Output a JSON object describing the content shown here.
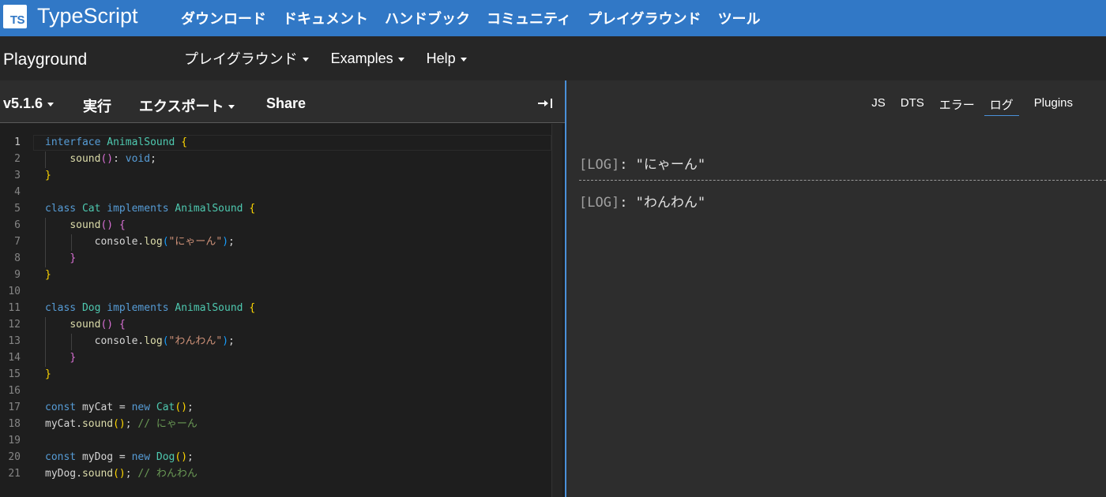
{
  "brand": {
    "logo_text": "TS",
    "name": "TypeScript"
  },
  "topnav": [
    {
      "label": "ダウンロード"
    },
    {
      "label": "ドキュメント"
    },
    {
      "label": "ハンドブック"
    },
    {
      "label": "コミュニティ"
    },
    {
      "label": "プレイグラウンド"
    },
    {
      "label": "ツール"
    }
  ],
  "subbar": {
    "title": "Playground",
    "menus": [
      {
        "label": "プレイグラウンド"
      },
      {
        "label": "Examples"
      },
      {
        "label": "Help"
      }
    ]
  },
  "toolbar": {
    "version": "v5.1.6",
    "run": "実行",
    "export": "エクスポート",
    "share": "Share"
  },
  "editor": {
    "active_line": 1,
    "line_numbers": [
      "1",
      "2",
      "3",
      "4",
      "5",
      "6",
      "7",
      "8",
      "9",
      "10",
      "11",
      "12",
      "13",
      "14",
      "15",
      "16",
      "17",
      "18",
      "19",
      "20",
      "21"
    ]
  },
  "output": {
    "tabs": [
      {
        "label": "JS",
        "active": false
      },
      {
        "label": "DTS",
        "active": false
      },
      {
        "label": "エラー",
        "active": false
      },
      {
        "label": "ログ",
        "active": true
      },
      {
        "label": "Plugins",
        "active": false
      }
    ],
    "logs": [
      {
        "tag": "[LOG]",
        "sep": ": ",
        "value": "\"にゃーん\""
      },
      {
        "tag": "[LOG]",
        "sep": ": ",
        "value": "\"わんわん\""
      }
    ]
  },
  "colors": {
    "brand_blue": "#3178c6",
    "keyword": "#569cd6",
    "type": "#4ec9b0",
    "string": "#ce9178",
    "comment": "#6a9955",
    "bracket1": "#ffd700",
    "bracket2": "#da70d6",
    "bracket3": "#179fff"
  }
}
